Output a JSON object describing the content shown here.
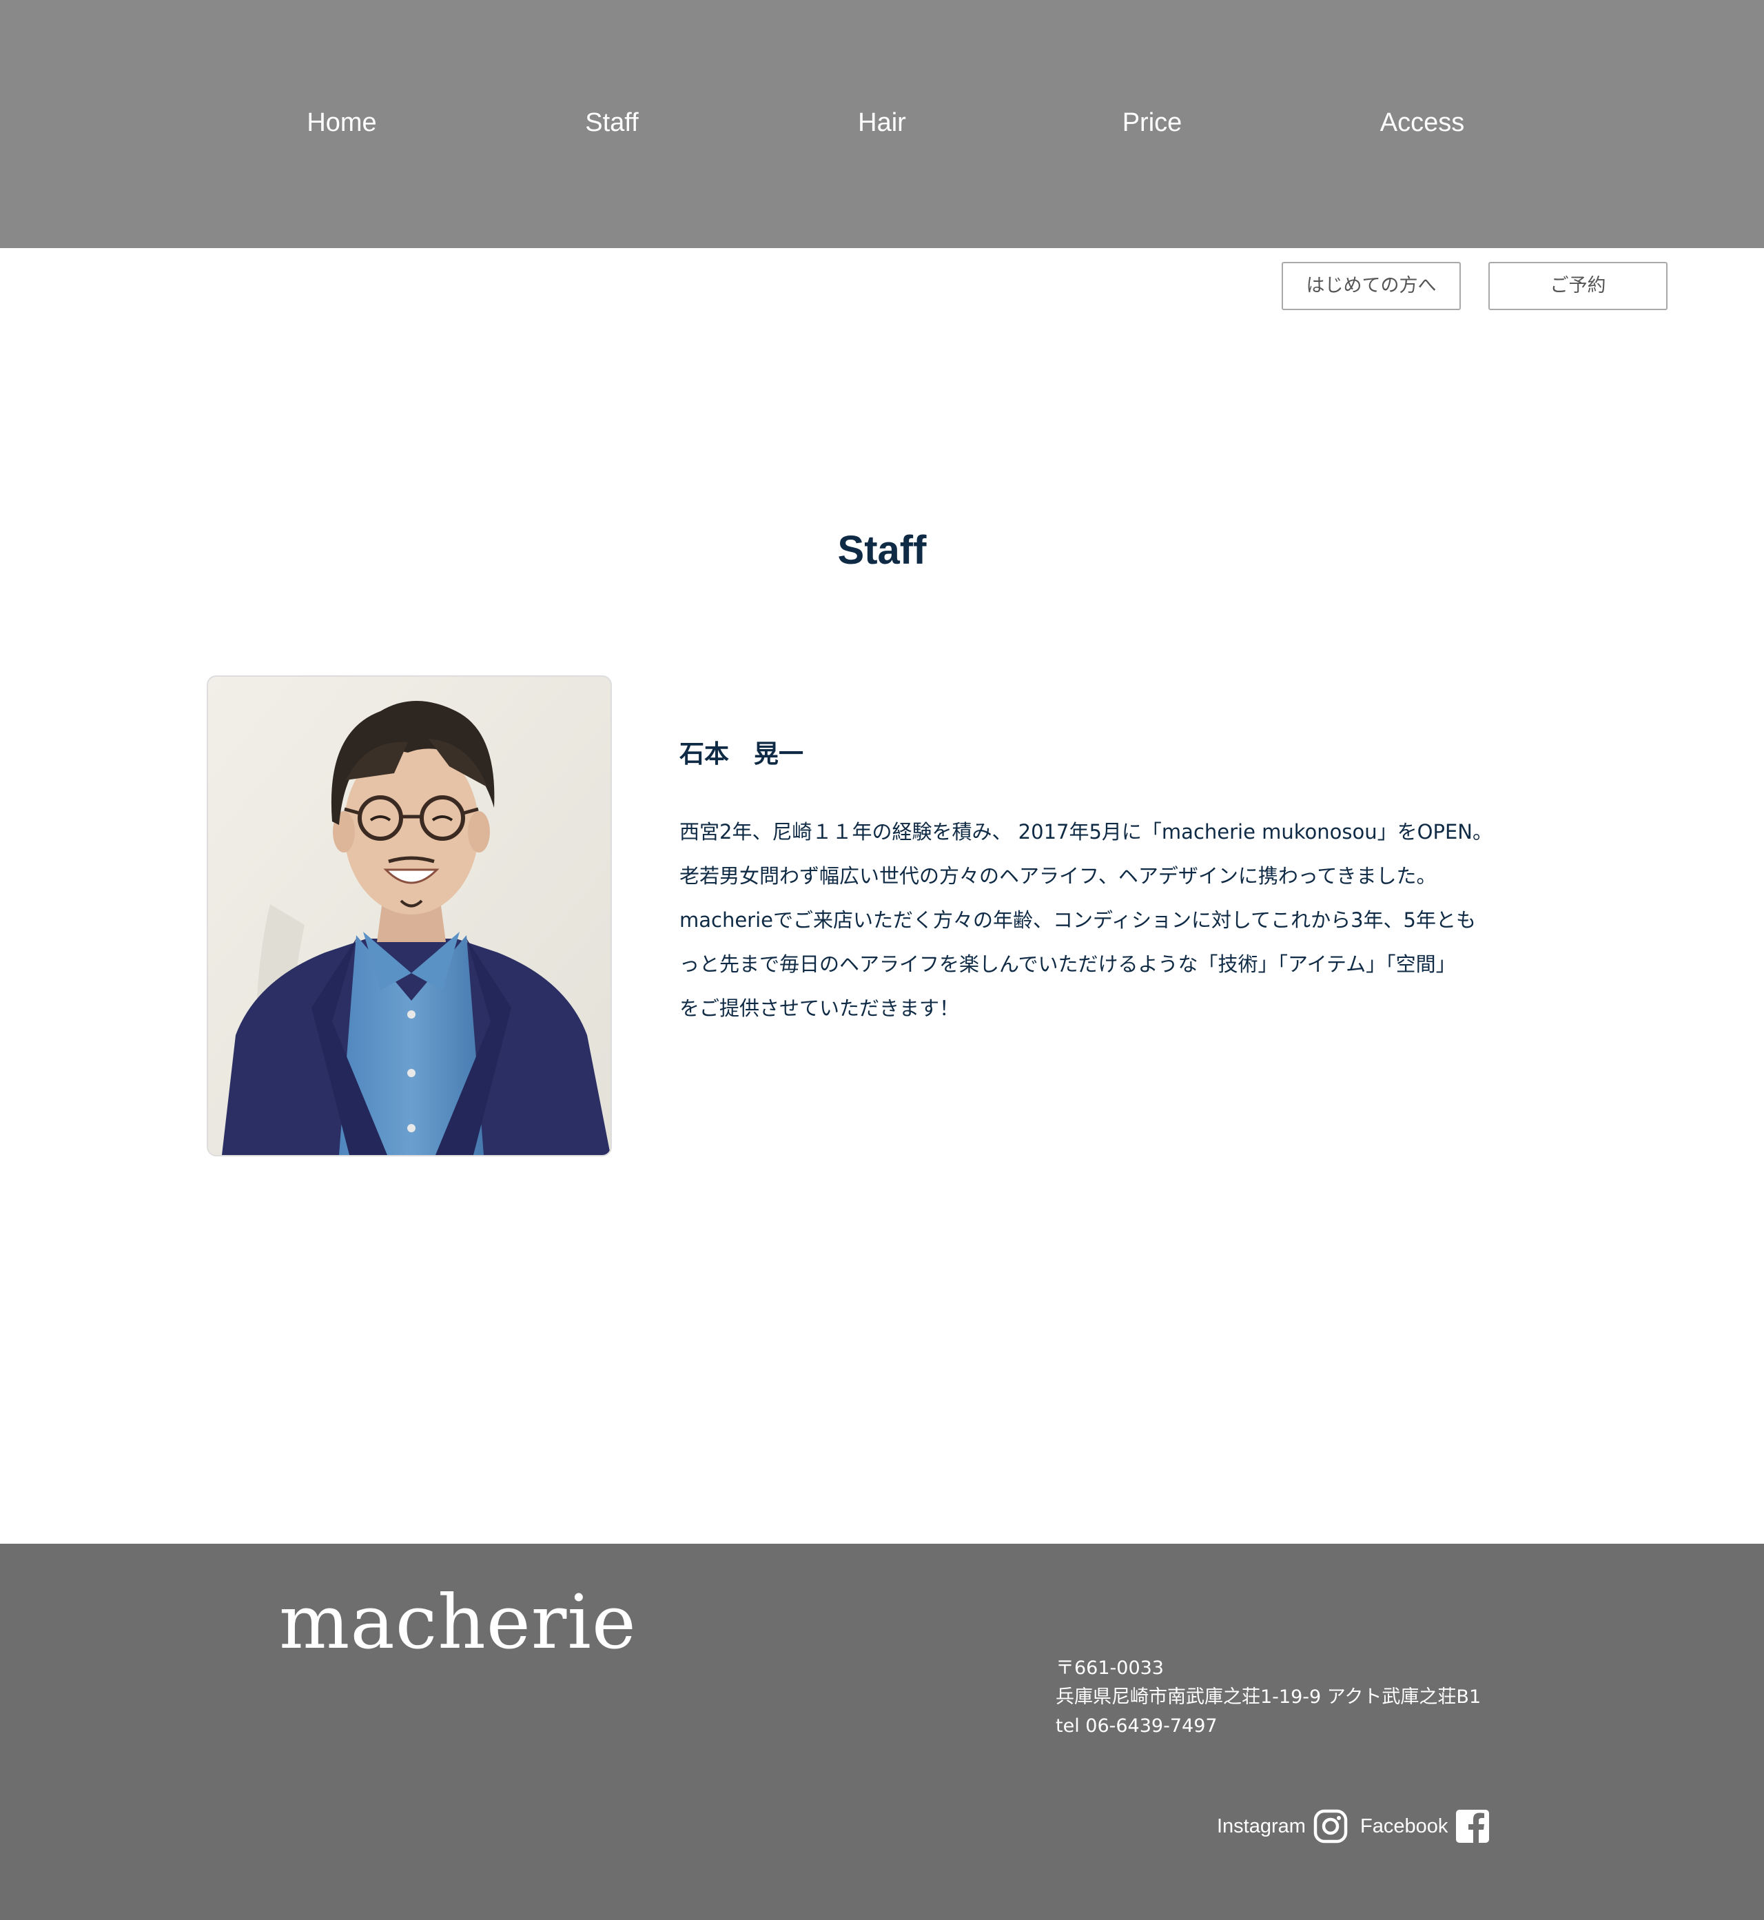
{
  "nav": {
    "items": [
      {
        "label": "Home"
      },
      {
        "label": "Staff"
      },
      {
        "label": "Hair"
      },
      {
        "label": "Price"
      },
      {
        "label": "Access"
      }
    ]
  },
  "actions": {
    "first_time_label": "はじめての方へ",
    "reserve_label": "ご予約"
  },
  "section": {
    "title": "Staff"
  },
  "staff": {
    "name": "石本　晃一",
    "bio_lines": [
      "西宮2年、尼崎１１年の経験を積み、 2017年5月に「macherie mukonosou」をOPEN。",
      "老若男女問わず幅広い世代の方々のヘアライフ、ヘアデザインに携わってきました。",
      "macherieでご来店いただく方々の年齢、コンディションに対してこれから3年、5年とも",
      "っと先まで毎日のヘアライフを楽しんでいただけるような「技術」「アイテム」「空間」",
      "をご提供させていただきます！"
    ]
  },
  "footer": {
    "logo": "macherie",
    "postal": "〒661-0033",
    "address": "兵庫県尼崎市南武庫之荘1-19-9 アクト武庫之荘B1",
    "tel": "tel 06-6439-7497",
    "social": {
      "instagram_label": "Instagram",
      "facebook_label": "Facebook"
    }
  },
  "colors": {
    "header_bg": "#8a898a",
    "footer_bg": "#6e6e6e",
    "heading_navy": "#0f2a44",
    "button_border": "#a9a9a9"
  },
  "icons": {
    "instagram": "instagram-icon",
    "facebook": "facebook-icon"
  }
}
